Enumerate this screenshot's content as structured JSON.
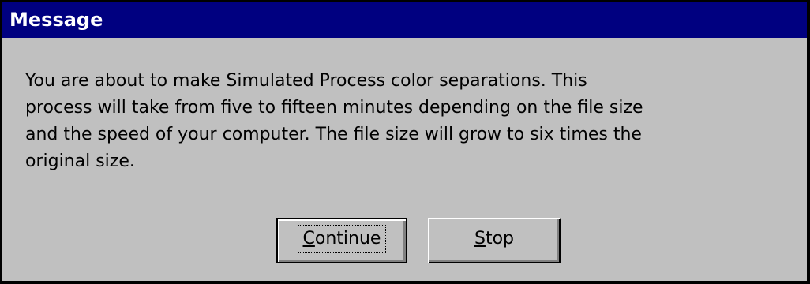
{
  "window": {
    "title": "Message"
  },
  "message": {
    "text": "You are about to make Simulated Process color separations.  This\nprocess will take from five to fifteen minutes depending on the file size\nand the speed of your computer. The file size will grow to six times the\noriginal size."
  },
  "buttons": {
    "continue": {
      "mnemonic": "C",
      "rest": "ontinue",
      "is_default": true
    },
    "stop": {
      "mnemonic": "S",
      "rest": "top",
      "is_default": false
    }
  },
  "colors": {
    "title_bar": "#000080",
    "title_text": "#ffffff",
    "dialog_face": "#c0c0c0",
    "text": "#000000"
  }
}
